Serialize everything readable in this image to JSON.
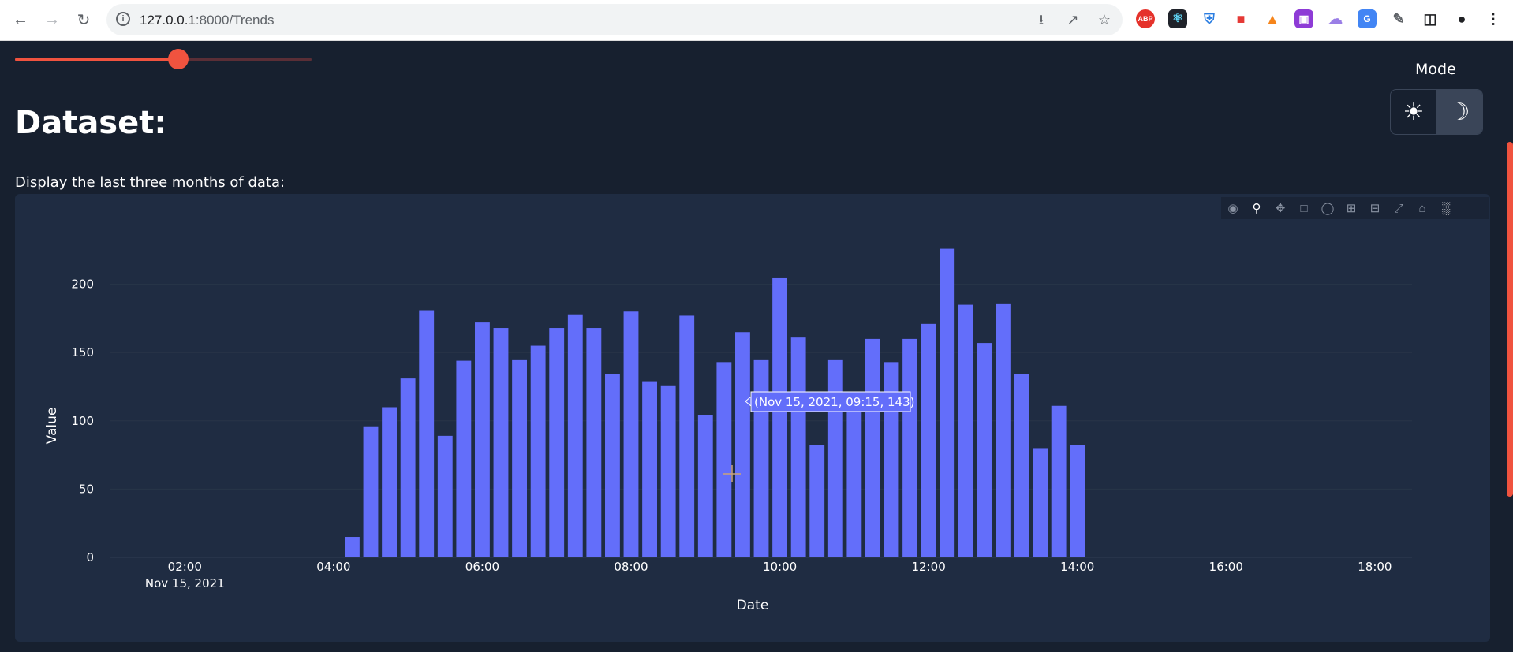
{
  "browser": {
    "url_host": "127.0.0.1",
    "url_path": ":8000/Trends",
    "extensions": [
      "ABP",
      "react-devtools",
      "shield",
      "bag",
      "metamask",
      "ext-purple",
      "ghost",
      "translate",
      "puzzle",
      "sidebar",
      "panda",
      "menu"
    ]
  },
  "slider": {
    "fraction": 0.55
  },
  "mode": {
    "label": "Mode",
    "options": [
      "light",
      "dark"
    ],
    "selected": "dark"
  },
  "page": {
    "heading": "Dataset:",
    "subtext": "Display the last three months of data:"
  },
  "colors": {
    "bar": "#636efa",
    "accent": "#f0533f",
    "background": "#17202f",
    "card": "#1f2c42"
  },
  "tooltip": {
    "text": "(Nov 15, 2021, 09:15, 143)"
  },
  "chart_data": {
    "type": "bar",
    "xlabel": "Date",
    "ylabel": "Value",
    "x_range": [
      "01:00",
      "18:30"
    ],
    "ylim": [
      0,
      235
    ],
    "yticks": [
      0,
      50,
      100,
      150,
      200
    ],
    "xticks": [
      {
        "time": "02:00",
        "label": "02:00",
        "sub": "Nov 15, 2021"
      },
      {
        "time": "04:00",
        "label": "04:00"
      },
      {
        "time": "06:00",
        "label": "06:00"
      },
      {
        "time": "08:00",
        "label": "08:00"
      },
      {
        "time": "10:00",
        "label": "10:00"
      },
      {
        "time": "12:00",
        "label": "12:00"
      },
      {
        "time": "14:00",
        "label": "14:00"
      },
      {
        "time": "16:00",
        "label": "16:00"
      },
      {
        "time": "18:00",
        "label": "18:00"
      }
    ],
    "x": [
      "04:15",
      "04:30",
      "04:45",
      "05:00",
      "05:15",
      "05:30",
      "05:45",
      "06:00",
      "06:15",
      "06:30",
      "06:45",
      "07:00",
      "07:15",
      "07:30",
      "07:45",
      "08:00",
      "08:15",
      "08:30",
      "08:45",
      "09:00",
      "09:15",
      "09:30",
      "09:45",
      "10:00",
      "10:15",
      "10:30",
      "10:45",
      "11:00",
      "11:15",
      "11:30",
      "11:45",
      "12:00",
      "12:15",
      "12:30",
      "12:45",
      "13:00",
      "13:15",
      "13:30",
      "13:45",
      "14:00"
    ],
    "values": [
      15,
      96,
      110,
      131,
      181,
      89,
      144,
      172,
      168,
      145,
      155,
      168,
      178,
      168,
      134,
      180,
      129,
      126,
      177,
      104,
      143,
      165,
      145,
      205,
      161,
      82,
      145,
      120,
      160,
      143,
      160,
      171,
      226,
      185,
      157,
      186,
      134,
      80,
      111,
      82
    ],
    "grid": true,
    "legend": "none"
  }
}
